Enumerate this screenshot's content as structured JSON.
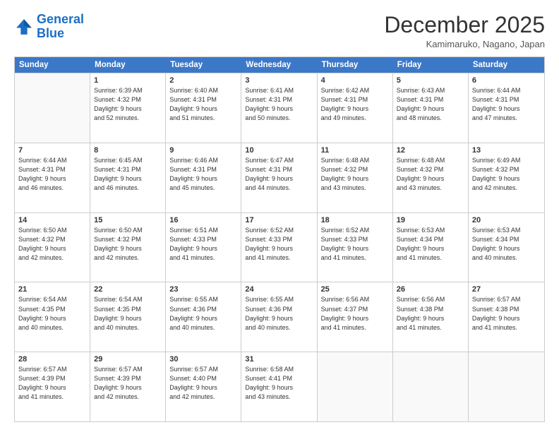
{
  "header": {
    "logo_line1": "General",
    "logo_line2": "Blue",
    "month": "December 2025",
    "location": "Kamimaruko, Nagano, Japan"
  },
  "calendar": {
    "weekdays": [
      "Sunday",
      "Monday",
      "Tuesday",
      "Wednesday",
      "Thursday",
      "Friday",
      "Saturday"
    ],
    "weeks": [
      [
        {
          "day": "",
          "info": ""
        },
        {
          "day": "1",
          "info": "Sunrise: 6:39 AM\nSunset: 4:32 PM\nDaylight: 9 hours\nand 52 minutes."
        },
        {
          "day": "2",
          "info": "Sunrise: 6:40 AM\nSunset: 4:31 PM\nDaylight: 9 hours\nand 51 minutes."
        },
        {
          "day": "3",
          "info": "Sunrise: 6:41 AM\nSunset: 4:31 PM\nDaylight: 9 hours\nand 50 minutes."
        },
        {
          "day": "4",
          "info": "Sunrise: 6:42 AM\nSunset: 4:31 PM\nDaylight: 9 hours\nand 49 minutes."
        },
        {
          "day": "5",
          "info": "Sunrise: 6:43 AM\nSunset: 4:31 PM\nDaylight: 9 hours\nand 48 minutes."
        },
        {
          "day": "6",
          "info": "Sunrise: 6:44 AM\nSunset: 4:31 PM\nDaylight: 9 hours\nand 47 minutes."
        }
      ],
      [
        {
          "day": "7",
          "info": "Sunrise: 6:44 AM\nSunset: 4:31 PM\nDaylight: 9 hours\nand 46 minutes."
        },
        {
          "day": "8",
          "info": "Sunrise: 6:45 AM\nSunset: 4:31 PM\nDaylight: 9 hours\nand 46 minutes."
        },
        {
          "day": "9",
          "info": "Sunrise: 6:46 AM\nSunset: 4:31 PM\nDaylight: 9 hours\nand 45 minutes."
        },
        {
          "day": "10",
          "info": "Sunrise: 6:47 AM\nSunset: 4:31 PM\nDaylight: 9 hours\nand 44 minutes."
        },
        {
          "day": "11",
          "info": "Sunrise: 6:48 AM\nSunset: 4:32 PM\nDaylight: 9 hours\nand 43 minutes."
        },
        {
          "day": "12",
          "info": "Sunrise: 6:48 AM\nSunset: 4:32 PM\nDaylight: 9 hours\nand 43 minutes."
        },
        {
          "day": "13",
          "info": "Sunrise: 6:49 AM\nSunset: 4:32 PM\nDaylight: 9 hours\nand 42 minutes."
        }
      ],
      [
        {
          "day": "14",
          "info": "Sunrise: 6:50 AM\nSunset: 4:32 PM\nDaylight: 9 hours\nand 42 minutes."
        },
        {
          "day": "15",
          "info": "Sunrise: 6:50 AM\nSunset: 4:32 PM\nDaylight: 9 hours\nand 42 minutes."
        },
        {
          "day": "16",
          "info": "Sunrise: 6:51 AM\nSunset: 4:33 PM\nDaylight: 9 hours\nand 41 minutes."
        },
        {
          "day": "17",
          "info": "Sunrise: 6:52 AM\nSunset: 4:33 PM\nDaylight: 9 hours\nand 41 minutes."
        },
        {
          "day": "18",
          "info": "Sunrise: 6:52 AM\nSunset: 4:33 PM\nDaylight: 9 hours\nand 41 minutes."
        },
        {
          "day": "19",
          "info": "Sunrise: 6:53 AM\nSunset: 4:34 PM\nDaylight: 9 hours\nand 41 minutes."
        },
        {
          "day": "20",
          "info": "Sunrise: 6:53 AM\nSunset: 4:34 PM\nDaylight: 9 hours\nand 40 minutes."
        }
      ],
      [
        {
          "day": "21",
          "info": "Sunrise: 6:54 AM\nSunset: 4:35 PM\nDaylight: 9 hours\nand 40 minutes."
        },
        {
          "day": "22",
          "info": "Sunrise: 6:54 AM\nSunset: 4:35 PM\nDaylight: 9 hours\nand 40 minutes."
        },
        {
          "day": "23",
          "info": "Sunrise: 6:55 AM\nSunset: 4:36 PM\nDaylight: 9 hours\nand 40 minutes."
        },
        {
          "day": "24",
          "info": "Sunrise: 6:55 AM\nSunset: 4:36 PM\nDaylight: 9 hours\nand 40 minutes."
        },
        {
          "day": "25",
          "info": "Sunrise: 6:56 AM\nSunset: 4:37 PM\nDaylight: 9 hours\nand 41 minutes."
        },
        {
          "day": "26",
          "info": "Sunrise: 6:56 AM\nSunset: 4:38 PM\nDaylight: 9 hours\nand 41 minutes."
        },
        {
          "day": "27",
          "info": "Sunrise: 6:57 AM\nSunset: 4:38 PM\nDaylight: 9 hours\nand 41 minutes."
        }
      ],
      [
        {
          "day": "28",
          "info": "Sunrise: 6:57 AM\nSunset: 4:39 PM\nDaylight: 9 hours\nand 41 minutes."
        },
        {
          "day": "29",
          "info": "Sunrise: 6:57 AM\nSunset: 4:39 PM\nDaylight: 9 hours\nand 42 minutes."
        },
        {
          "day": "30",
          "info": "Sunrise: 6:57 AM\nSunset: 4:40 PM\nDaylight: 9 hours\nand 42 minutes."
        },
        {
          "day": "31",
          "info": "Sunrise: 6:58 AM\nSunset: 4:41 PM\nDaylight: 9 hours\nand 43 minutes."
        },
        {
          "day": "",
          "info": ""
        },
        {
          "day": "",
          "info": ""
        },
        {
          "day": "",
          "info": ""
        }
      ]
    ]
  }
}
